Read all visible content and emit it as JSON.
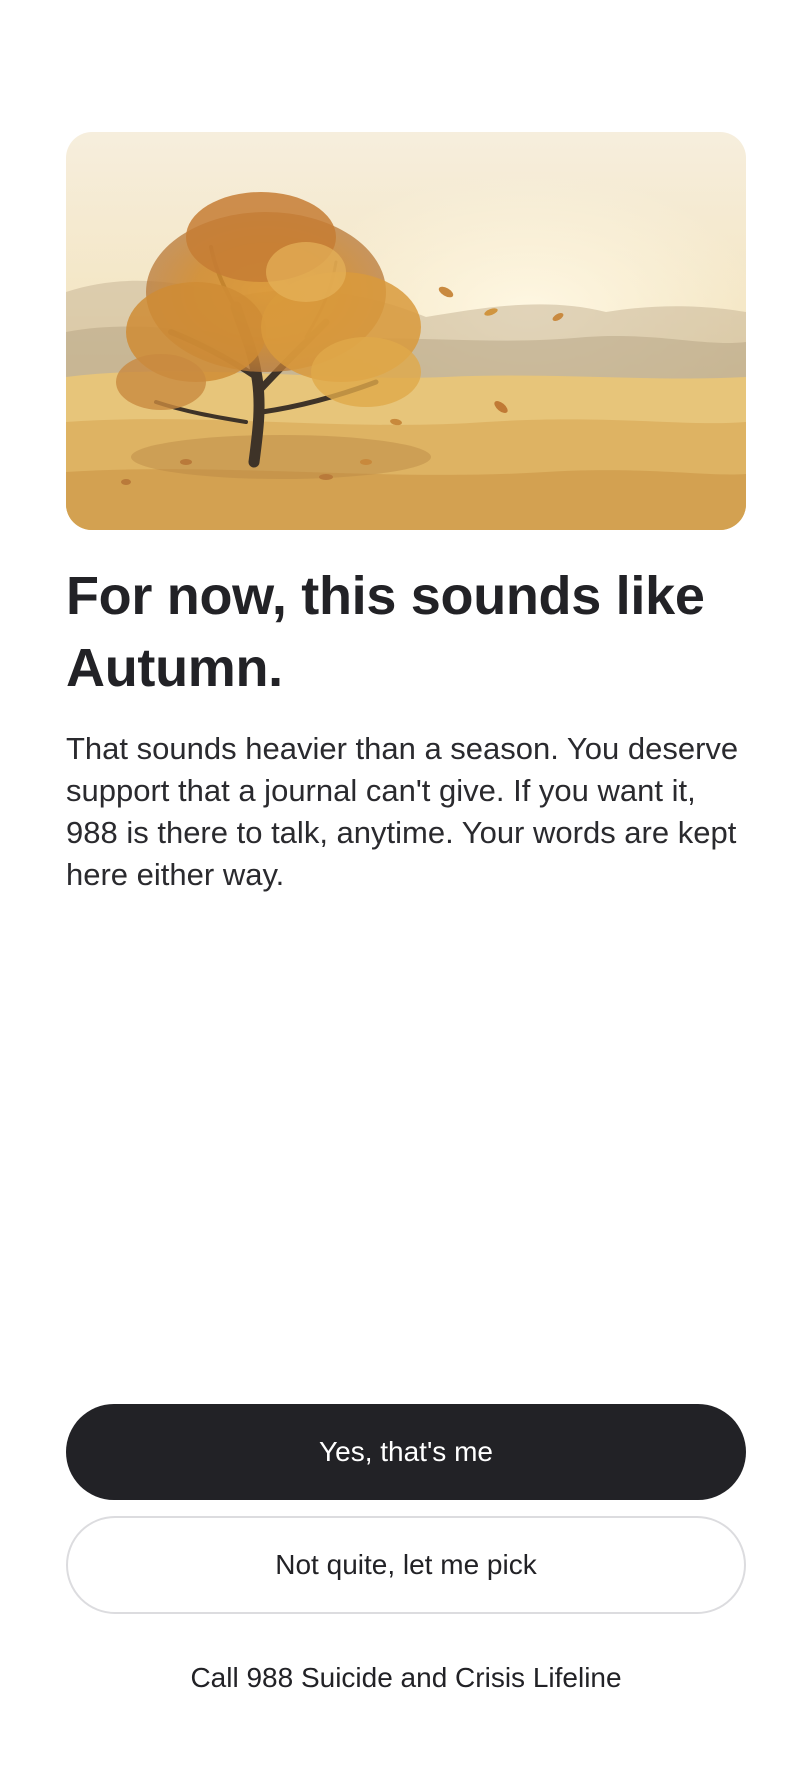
{
  "hero": {
    "image_label": "autumn-tree-watercolor"
  },
  "result": {
    "headline": "For now, this sounds like Autumn.",
    "message": "That sounds heavier than a season. You deserve support that a journal can't give. If you want it, 988 is there to talk, anytime. Your words are kept here either way."
  },
  "actions": {
    "confirm_label": "Yes, that's me",
    "pick_label": "Not quite, let me pick",
    "crisis_link_label": "Call 988 Suicide and Crisis Lifeline"
  },
  "colors": {
    "primary_button": "#222226",
    "text": "#222226",
    "secondary_border": "#dcdcdf",
    "background": "#ffffff"
  }
}
